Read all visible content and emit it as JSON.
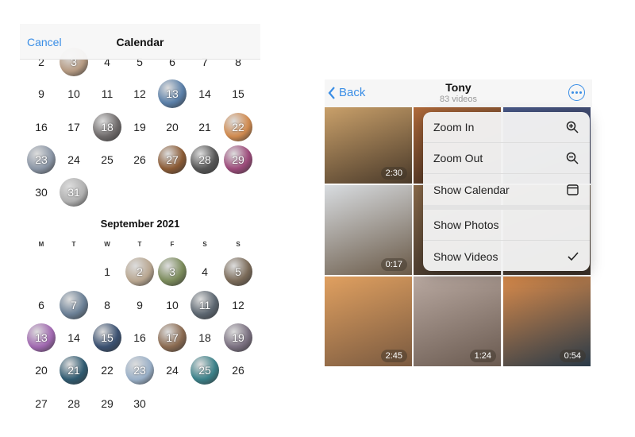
{
  "calendar": {
    "cancel_label": "Cancel",
    "title": "Calendar",
    "august": {
      "rows": [
        [
          2,
          3,
          4,
          5,
          6,
          7,
          8
        ],
        [
          9,
          10,
          11,
          12,
          13,
          14,
          15
        ],
        [
          16,
          17,
          18,
          19,
          20,
          21,
          22
        ],
        [
          23,
          24,
          25,
          26,
          27,
          28,
          29
        ],
        [
          30,
          31
        ]
      ],
      "photo_days": {
        "3": "#b59a82",
        "13": "#5a7fa8",
        "18": "#6e6a6a",
        "22": "#d08a4f",
        "23": "#8a95a5",
        "27": "#8a5a34",
        "28": "#555555",
        "29": "#9c4a7a",
        "31": "#b0b0b0"
      }
    },
    "september": {
      "title": "September 2021",
      "weekdays": [
        "M",
        "T",
        "W",
        "T",
        "F",
        "S",
        "S"
      ],
      "rows": [
        [
          null,
          null,
          1,
          2,
          3,
          4,
          5
        ],
        [
          6,
          7,
          8,
          9,
          10,
          11,
          12
        ],
        [
          13,
          14,
          15,
          16,
          17,
          18,
          19
        ],
        [
          20,
          21,
          22,
          23,
          24,
          25,
          26
        ],
        [
          27,
          28,
          29,
          30
        ]
      ],
      "photo_days": {
        "2": "#b8a690",
        "3": "#7a8a5a",
        "5": "#7a6a58",
        "7": "#6a7f95",
        "11": "#5c6670",
        "13": "#a068b0",
        "15": "#3a5070",
        "17": "#8a6a50",
        "19": "#7a7080",
        "21": "#2f5a70",
        "23": "#9ab0c8",
        "25": "#3a8088"
      }
    }
  },
  "videos": {
    "back_label": "Back",
    "title": "Tony",
    "subtitle": "83 videos",
    "tiles": [
      {
        "duration": "2:30",
        "colors": [
          "#c9a06a",
          "#4a3a2a"
        ]
      },
      {
        "duration": "",
        "colors": [
          "#b06a3a",
          "#3a2a20"
        ]
      },
      {
        "duration": "",
        "colors": [
          "#4a5a8a",
          "#2a2a3a"
        ]
      },
      {
        "duration": "0:17",
        "colors": [
          "#d8dce0",
          "#6a5a48"
        ]
      },
      {
        "duration": "",
        "colors": [
          "#8a6a4a",
          "#3a3028"
        ]
      },
      {
        "duration": "",
        "colors": [
          "#7a6a5a",
          "#3a3028"
        ]
      },
      {
        "duration": "2:45",
        "colors": [
          "#e0a060",
          "#7a5a40"
        ]
      },
      {
        "duration": "1:24",
        "colors": [
          "#b8a8a0",
          "#6a5a50"
        ]
      },
      {
        "duration": "0:54",
        "colors": [
          "#d88a4a",
          "#2a3a48"
        ]
      }
    ],
    "menu": [
      {
        "label": "Zoom In",
        "icon": "zoom-in-icon"
      },
      {
        "label": "Zoom Out",
        "icon": "zoom-out-icon"
      },
      {
        "label": "Show Calendar",
        "icon": "calendar-icon"
      },
      {
        "label": "Show Photos",
        "icon": ""
      },
      {
        "label": "Show Videos",
        "icon": "checkmark-icon"
      }
    ]
  }
}
